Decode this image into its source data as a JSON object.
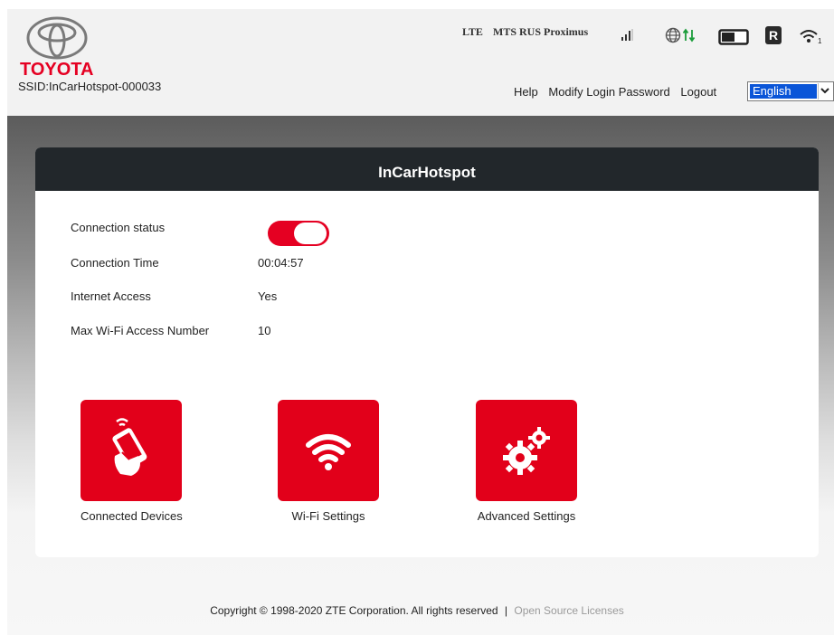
{
  "header": {
    "brand": "TOYOTA",
    "ssid": "SSID:InCarHotspot-000033",
    "status": {
      "network_type": "LTE",
      "operator": "MTS RUS Proximus",
      "roaming_badge": "R",
      "wifi_users": "1"
    },
    "links": {
      "help": "Help",
      "modify_password": "Modify Login Password",
      "logout": "Logout"
    },
    "language": "English"
  },
  "card": {
    "title": "InCarHotspot",
    "rows": [
      {
        "label": "Connection status",
        "value": ""
      },
      {
        "label": "Connection Time",
        "value": "00:04:57"
      },
      {
        "label": "Internet Access",
        "value": "Yes"
      },
      {
        "label": "Max Wi-Fi Access Number",
        "value": "10"
      }
    ],
    "connection_on": true,
    "tiles": [
      {
        "label": "Connected Devices",
        "icon": "hand-phone-icon"
      },
      {
        "label": "Wi-Fi Settings",
        "icon": "wifi-icon"
      },
      {
        "label": "Advanced Settings",
        "icon": "gears-icon"
      }
    ]
  },
  "footer": {
    "copyright": "Copyright © 1998-2020 ZTE Corporation. All rights reserved",
    "separator": "|",
    "oss_link": "Open Source Licenses"
  },
  "colors": {
    "brand_red": "#e50022",
    "header_dark": "#22272b",
    "select_blue": "#0a55d8"
  }
}
